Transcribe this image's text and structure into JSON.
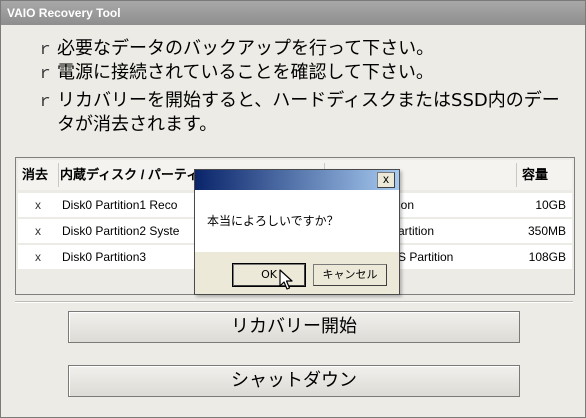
{
  "window": {
    "title": "VAIO Recovery Tool"
  },
  "notes": [
    "必要なデータのバックアップを行って下さい。",
    "電源に接続されていることを確認して下さい。",
    "リカバリーを開始すると、ハードディスクまたはSSD内のデータが消去されます。"
  ],
  "table": {
    "headers": {
      "erase": "消去",
      "partition": "内蔵ディスク / パーティ",
      "size": "容量"
    },
    "rows": [
      {
        "erase": "x",
        "partition": "Disk0  Partition1  Reco",
        "type": "ion",
        "size": "10GB"
      },
      {
        "erase": "x",
        "partition": "Disk0  Partition2  Syste",
        "type": "artition",
        "size": "350MB"
      },
      {
        "erase": "x",
        "partition": "Disk0  Partition3",
        "type": "S  Partition",
        "size": "108GB"
      }
    ]
  },
  "buttons": {
    "recover": "リカバリー開始",
    "shutdown": "シャットダウン"
  },
  "dialog": {
    "message": "本当によろしいですか？",
    "ok": "OK",
    "cancel": "キャンセル",
    "close": "x"
  }
}
